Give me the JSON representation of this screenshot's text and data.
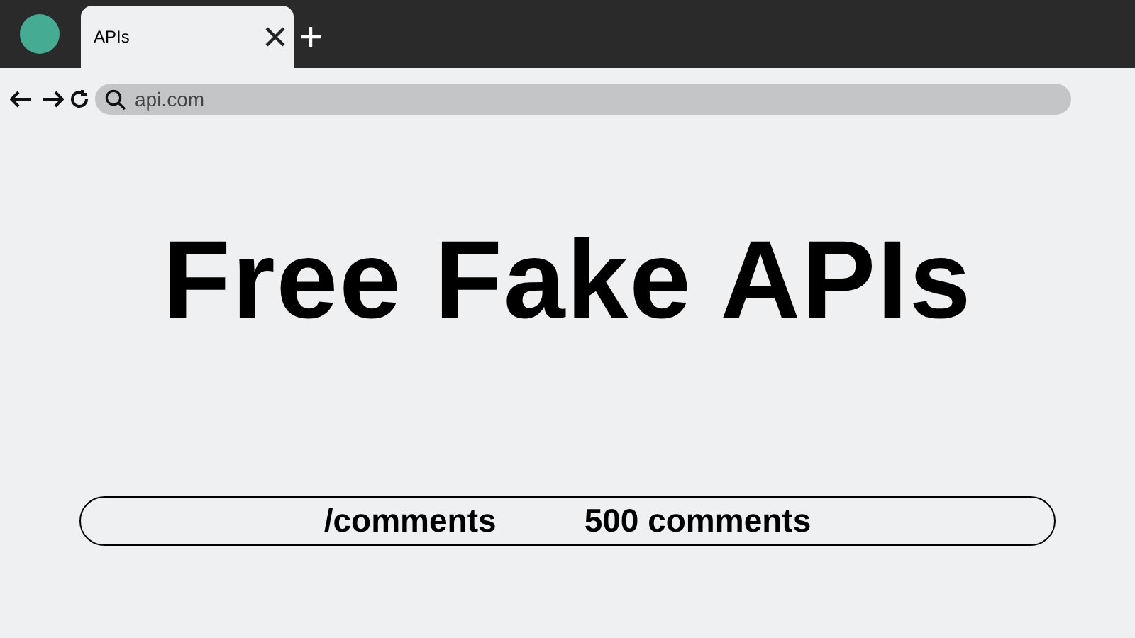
{
  "tabs": [
    {
      "label": "APIs",
      "selected": true
    }
  ],
  "address_bar": {
    "value": "api.com"
  },
  "heading": "Free Fake APIs",
  "endpoint": {
    "path": "/comments",
    "count": "500 comments"
  }
}
